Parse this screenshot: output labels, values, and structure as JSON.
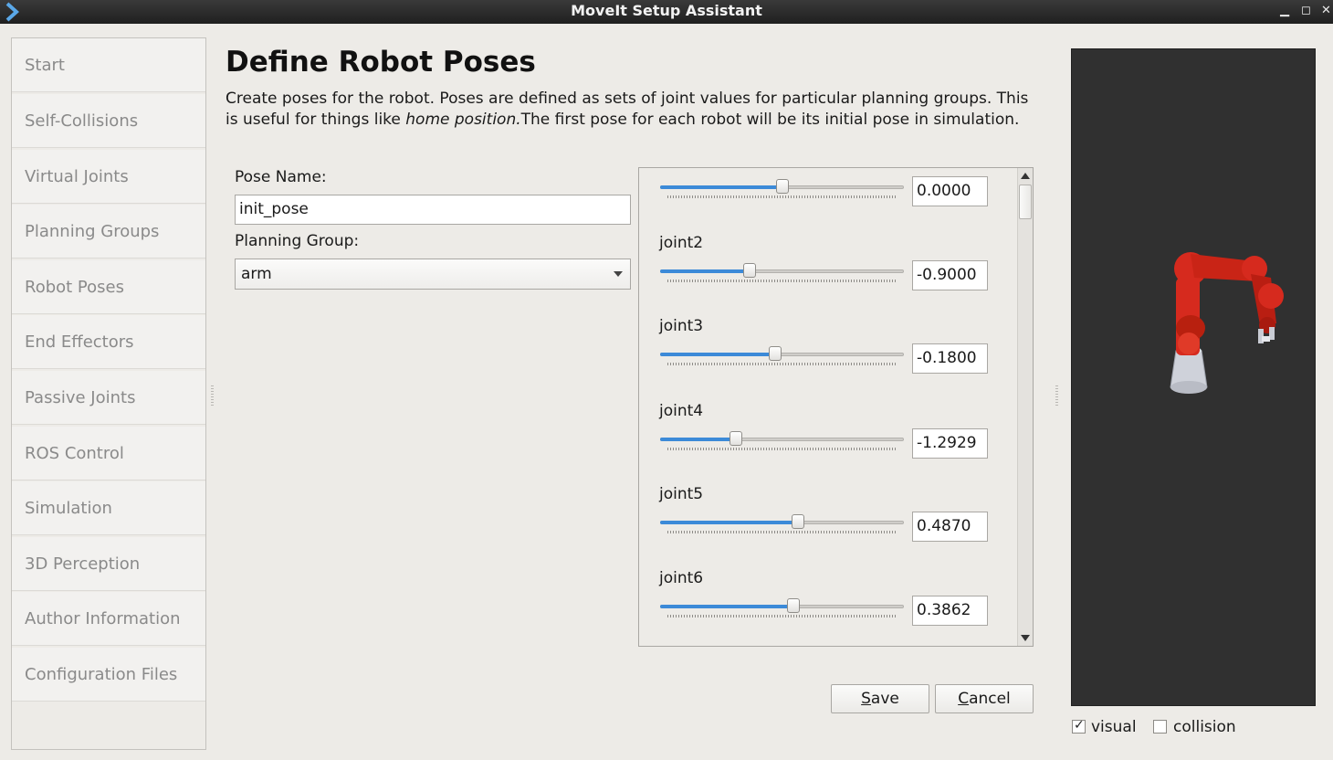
{
  "window": {
    "title": "MoveIt Setup Assistant"
  },
  "sidebar": {
    "items": [
      {
        "label": "Start"
      },
      {
        "label": "Self-Collisions"
      },
      {
        "label": "Virtual Joints"
      },
      {
        "label": "Planning Groups"
      },
      {
        "label": "Robot Poses"
      },
      {
        "label": "End Effectors"
      },
      {
        "label": "Passive Joints"
      },
      {
        "label": "ROS Control"
      },
      {
        "label": "Simulation"
      },
      {
        "label": "3D Perception"
      },
      {
        "label": "Author Information"
      },
      {
        "label": "Configuration Files"
      }
    ]
  },
  "page": {
    "title": "Define Robot Poses",
    "description_1": "Create poses for the robot. Poses are defined as sets of joint values for particular planning groups. This is useful for things like ",
    "description_em": "home position.",
    "description_2": "The first pose for each robot will be its initial pose in simulation."
  },
  "form": {
    "pose_name_label": "Pose Name:",
    "pose_name_value": "init_pose",
    "planning_group_label": "Planning Group:",
    "planning_group_value": "arm"
  },
  "joints": [
    {
      "name": "",
      "value": "0.0000",
      "slider_fraction": 0.5
    },
    {
      "name": "joint2",
      "value": "-0.9000",
      "slider_fraction": 0.36
    },
    {
      "name": "joint3",
      "value": "-0.1800",
      "slider_fraction": 0.47
    },
    {
      "name": "joint4",
      "value": "-1.2929",
      "slider_fraction": 0.3
    },
    {
      "name": "joint5",
      "value": "0.4870",
      "slider_fraction": 0.57
    },
    {
      "name": "joint6",
      "value": "0.3862",
      "slider_fraction": 0.55
    }
  ],
  "buttons": {
    "save_mnemonic": "S",
    "save_rest": "ave",
    "cancel_mnemonic": "C",
    "cancel_rest": "ancel"
  },
  "viewer": {
    "visual_label": "visual",
    "visual_checked": true,
    "collision_label": "collision",
    "collision_checked": false
  },
  "colors": {
    "accent": "#3c8ad8",
    "robot": "#d62a1e",
    "viewer_bg": "#303030"
  }
}
